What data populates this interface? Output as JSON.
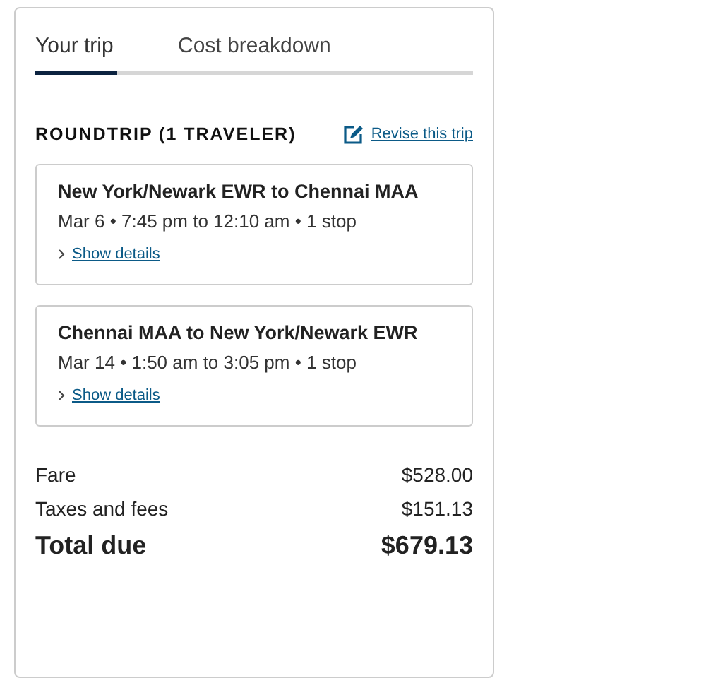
{
  "tabs": [
    {
      "label": "Your trip",
      "selected": true
    },
    {
      "label": "Cost breakdown",
      "selected": false
    }
  ],
  "trip": {
    "heading": "ROUNDTRIP (1 TRAVELER)",
    "revise_link": "Revise this trip"
  },
  "flights": [
    {
      "route": "New York/Newark EWR to Chennai MAA",
      "details": "Mar 6 • 7:45 pm to 12:10 am • 1 stop",
      "toggle": "Show details",
      "expanded": false
    },
    {
      "route": "Chennai MAA to New York/Newark EWR",
      "details": "Mar 14 • 1:50 am to 3:05 pm • 1 stop",
      "toggle": "Show details",
      "expanded": false
    }
  ],
  "costs": [
    {
      "label": "Fare",
      "amount": "$528.00",
      "kind": "line"
    },
    {
      "label": "Taxes and fees",
      "amount": "$151.13",
      "kind": "line"
    },
    {
      "label": "Total due",
      "amount": "$679.13",
      "kind": "total"
    }
  ]
}
